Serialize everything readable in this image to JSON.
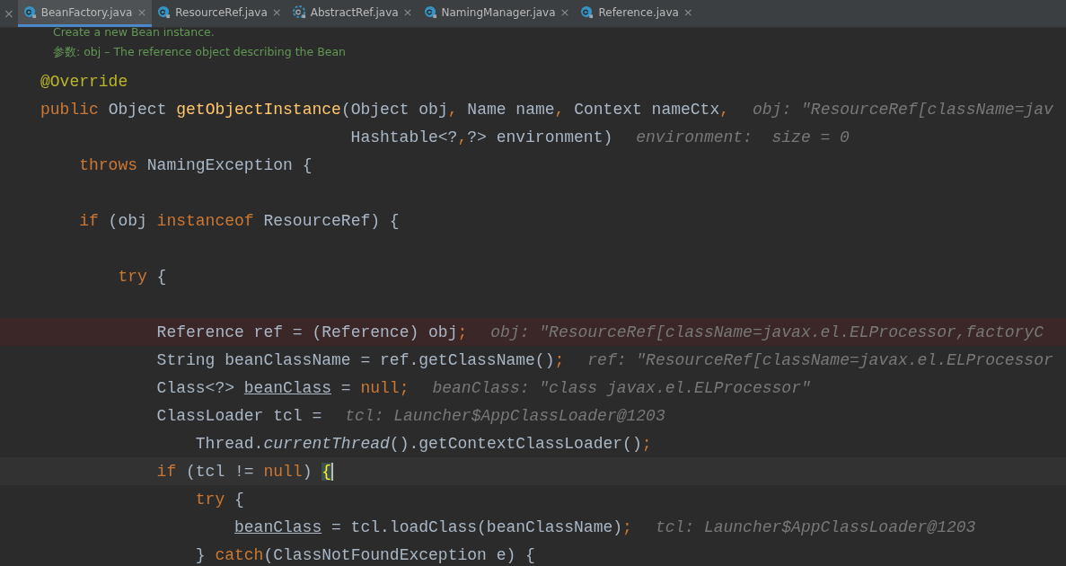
{
  "tab_bar": {
    "overflow_close": "×",
    "tabs": [
      {
        "label": "BeanFactory.java",
        "kind": "class",
        "close": "×",
        "selected": true
      },
      {
        "label": "ResourceRef.java",
        "kind": "class",
        "close": "×",
        "selected": false
      },
      {
        "label": "AbstractRef.java",
        "kind": "abstract_class",
        "close": "×",
        "selected": false
      },
      {
        "label": "NamingManager.java",
        "kind": "class",
        "close": "×",
        "selected": false
      },
      {
        "label": "Reference.java",
        "kind": "class",
        "close": "×",
        "selected": false
      }
    ]
  },
  "doc_comment": [
    "Create a new Bean instance.",
    "参数: obj – The reference object describing the Bean"
  ],
  "editor": {
    "lines": [
      {
        "kind": "code",
        "breakpoint": false,
        "current": false,
        "tokens": [
          {
            "kind": "annotation",
            "text": "@Override"
          }
        ]
      },
      {
        "kind": "code",
        "breakpoint": false,
        "current": false,
        "tokens": [
          {
            "kind": "keyword",
            "text": "public "
          },
          {
            "kind": "plain",
            "text": "Object "
          },
          {
            "kind": "method_decl",
            "text": "getObjectInstance"
          },
          {
            "kind": "plain",
            "text": "(Object obj"
          },
          {
            "kind": "punct",
            "text": ","
          },
          {
            "kind": "plain",
            "text": " Name name"
          },
          {
            "kind": "punct",
            "text": ","
          },
          {
            "kind": "plain",
            "text": " Context nameCtx"
          },
          {
            "kind": "punct",
            "text": ","
          }
        ],
        "hint": "obj: \"ResourceRef[className=jav",
        "children": [
          {
            "kind": "continuation",
            "breakpoint": false,
            "current": false,
            "tokens": [
              {
                "kind": "plain",
                "text": "Hashtable<?"
              },
              {
                "kind": "punct",
                "text": ","
              },
              {
                "kind": "plain",
                "text": "?> environment)"
              }
            ],
            "hint": "environment:  size = 0"
          },
          {
            "kind": "code",
            "breakpoint": false,
            "current": false,
            "tokens": [
              {
                "kind": "keyword",
                "text": "throws "
              },
              {
                "kind": "plain",
                "text": "NamingException {"
              }
            ]
          },
          {
            "kind": "blank"
          },
          {
            "kind": "code",
            "breakpoint": false,
            "current": false,
            "tokens": [
              {
                "kind": "keyword",
                "text": "if "
              },
              {
                "kind": "plain",
                "text": "(obj "
              },
              {
                "kind": "keyword",
                "text": "instanceof "
              },
              {
                "kind": "plain",
                "text": "ResourceRef) {"
              }
            ],
            "children": [
              {
                "kind": "blank"
              },
              {
                "kind": "code",
                "breakpoint": false,
                "current": false,
                "tokens": [
                  {
                    "kind": "keyword",
                    "text": "try "
                  },
                  {
                    "kind": "plain",
                    "text": "{"
                  }
                ],
                "children": [
                  {
                    "kind": "blank"
                  },
                  {
                    "kind": "code",
                    "breakpoint": true,
                    "current": false,
                    "tokens": [
                      {
                        "kind": "plain",
                        "text": "Reference ref = (Reference) obj"
                      },
                      {
                        "kind": "punct",
                        "text": ";"
                      }
                    ],
                    "hint": "obj: \"ResourceRef[className=javax.el.ELProcessor,factoryC"
                  },
                  {
                    "kind": "code",
                    "breakpoint": false,
                    "current": false,
                    "tokens": [
                      {
                        "kind": "plain",
                        "text": "String beanClassName = ref.getClassName()"
                      },
                      {
                        "kind": "punct",
                        "text": ";"
                      }
                    ],
                    "hint": "ref: \"ResourceRef[className=javax.el.ELProcessor"
                  },
                  {
                    "kind": "code",
                    "breakpoint": false,
                    "current": false,
                    "tokens": [
                      {
                        "kind": "plain",
                        "text": "Class<?> "
                      },
                      {
                        "kind": "variable",
                        "text": "beanClass"
                      },
                      {
                        "kind": "plain",
                        "text": " = "
                      },
                      {
                        "kind": "keyword",
                        "text": "null"
                      },
                      {
                        "kind": "punct",
                        "text": ";"
                      }
                    ],
                    "hint": "beanClass: \"class javax.el.ELProcessor\""
                  },
                  {
                    "kind": "code",
                    "breakpoint": false,
                    "current": false,
                    "tokens": [
                      {
                        "kind": "plain",
                        "text": "ClassLoader tcl ="
                      }
                    ],
                    "hint": "tcl: Launcher$AppClassLoader@1203",
                    "children": [
                      {
                        "kind": "code",
                        "breakpoint": false,
                        "current": false,
                        "tokens": [
                          {
                            "kind": "plain",
                            "text": "Thread."
                          },
                          {
                            "kind": "static_call",
                            "text": "currentThread"
                          },
                          {
                            "kind": "plain",
                            "text": "().getContextClassLoader()"
                          },
                          {
                            "kind": "punct",
                            "text": ";"
                          }
                        ]
                      }
                    ]
                  },
                  {
                    "kind": "code",
                    "breakpoint": false,
                    "current": true,
                    "tokens": [
                      {
                        "kind": "keyword",
                        "text": "if "
                      },
                      {
                        "kind": "plain",
                        "text": "(tcl != "
                      },
                      {
                        "kind": "keyword",
                        "text": "null"
                      },
                      {
                        "kind": "plain",
                        "text": ") "
                      },
                      {
                        "kind": "brace_match",
                        "text": "{"
                      }
                    ],
                    "children": [
                      {
                        "kind": "code",
                        "breakpoint": false,
                        "current": false,
                        "tokens": [
                          {
                            "kind": "keyword",
                            "text": "try "
                          },
                          {
                            "kind": "plain",
                            "text": "{"
                          }
                        ],
                        "children": [
                          {
                            "kind": "code",
                            "breakpoint": false,
                            "current": false,
                            "tokens": [
                              {
                                "kind": "variable",
                                "text": "beanClass"
                              },
                              {
                                "kind": "plain",
                                "text": " = tcl.loadClass(beanClassName)"
                              },
                              {
                                "kind": "punct",
                                "text": ";"
                              }
                            ],
                            "hint": "tcl: Launcher$AppClassLoader@1203"
                          }
                        ]
                      },
                      {
                        "kind": "code",
                        "breakpoint": false,
                        "current": false,
                        "tokens": [
                          {
                            "kind": "plain",
                            "text": "} "
                          },
                          {
                            "kind": "keyword",
                            "text": "catch"
                          },
                          {
                            "kind": "plain",
                            "text": "(ClassNotFoundException e) {"
                          }
                        ]
                      }
                    ]
                  }
                ]
              }
            ]
          }
        ]
      }
    ]
  }
}
